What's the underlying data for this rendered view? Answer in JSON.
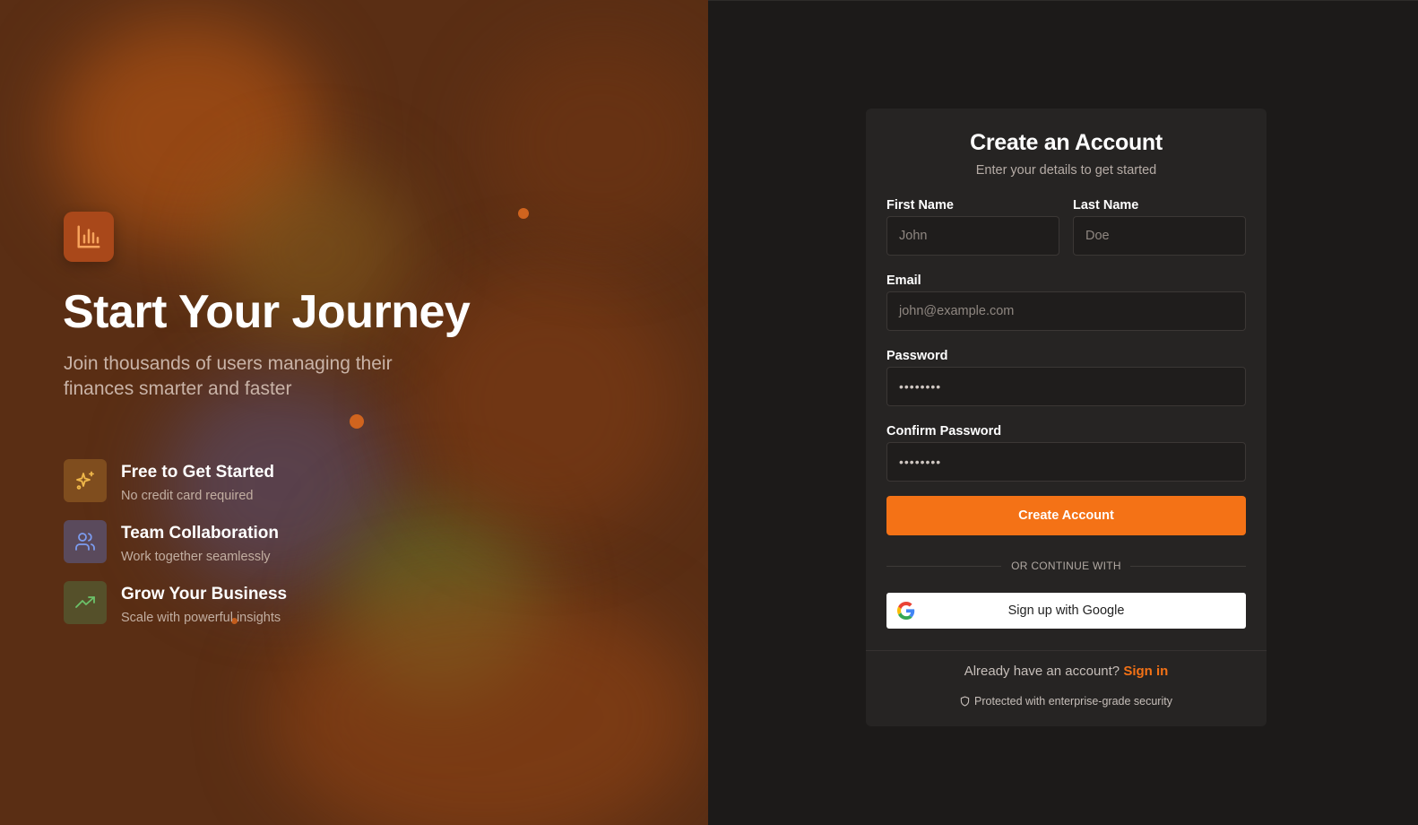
{
  "hero": {
    "title": "Start Your Journey",
    "subtitle": "Join thousands of users managing their finances smarter and faster",
    "logo_icon": "bar-chart-icon"
  },
  "features": [
    {
      "icon": "sparkles-icon",
      "title": "Free to Get Started",
      "description": "No credit card required"
    },
    {
      "icon": "users-icon",
      "title": "Team Collaboration",
      "description": "Work together seamlessly"
    },
    {
      "icon": "trending-up-icon",
      "title": "Grow Your Business",
      "description": "Scale with powerful insights"
    }
  ],
  "form": {
    "title": "Create an Account",
    "subtitle": "Enter your details to get started",
    "first_name": {
      "label": "First Name",
      "placeholder": "John"
    },
    "last_name": {
      "label": "Last Name",
      "placeholder": "Doe"
    },
    "email": {
      "label": "Email",
      "placeholder": "john@example.com"
    },
    "password": {
      "label": "Password",
      "value": "••••••••"
    },
    "confirm_password": {
      "label": "Confirm Password",
      "value": "••••••••"
    },
    "submit_label": "Create Account",
    "divider_text": "OR CONTINUE WITH",
    "google_label": "Sign up with Google",
    "signin_prompt": "Already have an account?",
    "signin_link": "Sign in",
    "security_note": "Protected with enterprise-grade security"
  },
  "colors": {
    "accent": "#f47216",
    "left_bg": "#5a2e14",
    "right_bg": "#1c1a19",
    "card_bg": "#262423"
  }
}
